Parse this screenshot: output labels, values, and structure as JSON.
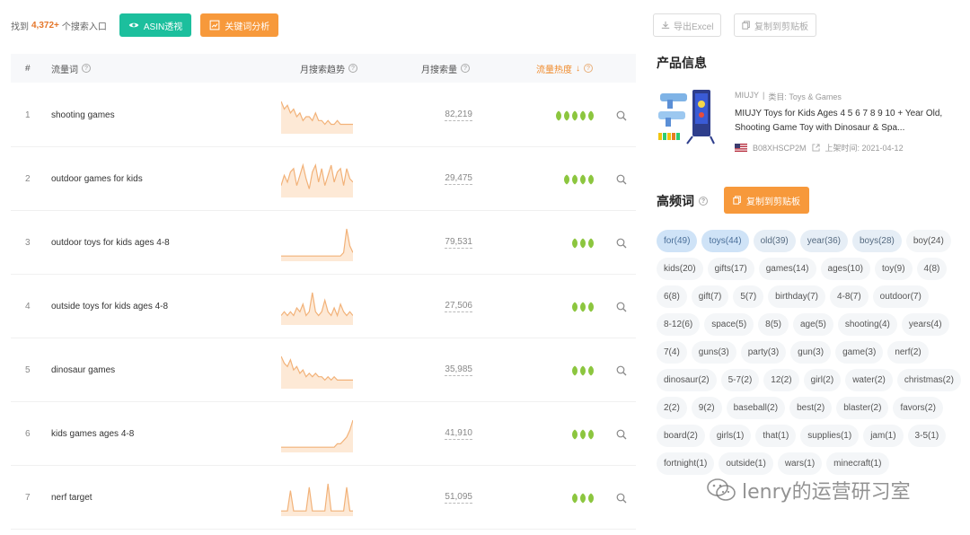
{
  "topbar": {
    "found_prefix": "找到",
    "found_count": "4,372+",
    "found_suffix": "个搜索入口",
    "asin_button": "ASIN透视",
    "keyword_button": "关键词分析"
  },
  "table": {
    "headers": {
      "index": "#",
      "keyword": "流量词",
      "trend": "月搜索趋势",
      "volume": "月搜索量",
      "heat": "流量热度"
    },
    "rows": [
      {
        "index": "1",
        "keyword": "shooting games",
        "volume": "82,219",
        "heat": 5,
        "trend": [
          8,
          6,
          7,
          5,
          6,
          4,
          5,
          3,
          4,
          4,
          3,
          5,
          3,
          3,
          2,
          3,
          2,
          2,
          3,
          2,
          2,
          2,
          2,
          2
        ]
      },
      {
        "index": "2",
        "keyword": "outdoor games for kids",
        "volume": "29,475",
        "heat": 4,
        "trend": [
          3,
          6,
          4,
          7,
          8,
          3,
          6,
          9,
          5,
          2,
          7,
          9,
          4,
          8,
          3,
          6,
          9,
          4,
          7,
          8,
          3,
          8,
          5,
          4
        ]
      },
      {
        "index": "3",
        "keyword": "outdoor toys for kids ages 4-8",
        "volume": "79,531",
        "heat": 3,
        "trend": [
          1,
          1,
          1,
          1,
          1,
          1,
          1,
          1,
          1,
          1,
          1,
          1,
          1,
          1,
          1,
          1,
          1,
          1,
          1,
          1,
          2,
          9,
          4,
          2
        ]
      },
      {
        "index": "4",
        "keyword": "outside toys for kids ages 4-8",
        "volume": "27,506",
        "heat": 3,
        "trend": [
          2,
          3,
          2,
          3,
          2,
          4,
          3,
          5,
          2,
          3,
          8,
          3,
          2,
          3,
          6,
          3,
          2,
          4,
          2,
          5,
          3,
          2,
          3,
          2
        ]
      },
      {
        "index": "5",
        "keyword": "dinosaur games",
        "volume": "35,985",
        "heat": 3,
        "trend": [
          9,
          7,
          6,
          8,
          5,
          6,
          4,
          5,
          3,
          4,
          3,
          4,
          3,
          3,
          2,
          3,
          2,
          3,
          2,
          2,
          2,
          2,
          2,
          2
        ]
      },
      {
        "index": "6",
        "keyword": "kids games ages 4-8",
        "volume": "41,910",
        "heat": 3,
        "trend": [
          1,
          1,
          1,
          1,
          1,
          1,
          1,
          1,
          1,
          1,
          1,
          1,
          1,
          1,
          1,
          1,
          1,
          1,
          2,
          2,
          3,
          4,
          6,
          9
        ]
      },
      {
        "index": "7",
        "keyword": "nerf target",
        "volume": "51,095",
        "heat": 3,
        "trend": [
          1,
          1,
          1,
          7,
          1,
          1,
          1,
          1,
          1,
          8,
          1,
          1,
          1,
          1,
          1,
          9,
          1,
          1,
          1,
          1,
          1,
          8,
          1,
          1
        ]
      }
    ]
  },
  "right": {
    "export_label": "导出Excel",
    "copy_clipboard_label": "复制到剪贴板",
    "product_title": "产品信息",
    "brand": "MIUJY",
    "category_label": "类目: Toys & Games",
    "product_name": "MIUJY Toys for Kids Ages 4 5 6 7 8 9 10 + Year Old, Shooting Game Toy with Dinosaur & Spa...",
    "asin": "B08XHSCP2M",
    "listing_date": "上架时间: 2021-04-12",
    "high_freq_title": "高频词",
    "copy_button_label": "复制到剪贴板",
    "tags": [
      {
        "text": "for(49)",
        "level": "hl"
      },
      {
        "text": "toys(44)",
        "level": "hl"
      },
      {
        "text": "old(39)",
        "level": "mid"
      },
      {
        "text": "year(36)",
        "level": "mid"
      },
      {
        "text": "boys(28)",
        "level": "mid"
      },
      {
        "text": "boy(24)",
        "level": ""
      },
      {
        "text": "kids(20)",
        "level": ""
      },
      {
        "text": "gifts(17)",
        "level": ""
      },
      {
        "text": "games(14)",
        "level": ""
      },
      {
        "text": "ages(10)",
        "level": ""
      },
      {
        "text": "toy(9)",
        "level": ""
      },
      {
        "text": "4(8)",
        "level": ""
      },
      {
        "text": "6(8)",
        "level": ""
      },
      {
        "text": "gift(7)",
        "level": ""
      },
      {
        "text": "5(7)",
        "level": ""
      },
      {
        "text": "birthday(7)",
        "level": ""
      },
      {
        "text": "4-8(7)",
        "level": ""
      },
      {
        "text": "outdoor(7)",
        "level": ""
      },
      {
        "text": "8-12(6)",
        "level": ""
      },
      {
        "text": "space(5)",
        "level": ""
      },
      {
        "text": "8(5)",
        "level": ""
      },
      {
        "text": "age(5)",
        "level": ""
      },
      {
        "text": "shooting(4)",
        "level": ""
      },
      {
        "text": "years(4)",
        "level": ""
      },
      {
        "text": "7(4)",
        "level": ""
      },
      {
        "text": "guns(3)",
        "level": ""
      },
      {
        "text": "party(3)",
        "level": ""
      },
      {
        "text": "gun(3)",
        "level": ""
      },
      {
        "text": "game(3)",
        "level": ""
      },
      {
        "text": "nerf(2)",
        "level": ""
      },
      {
        "text": "dinosaur(2)",
        "level": ""
      },
      {
        "text": "5-7(2)",
        "level": ""
      },
      {
        "text": "12(2)",
        "level": ""
      },
      {
        "text": "girl(2)",
        "level": ""
      },
      {
        "text": "water(2)",
        "level": ""
      },
      {
        "text": "christmas(2)",
        "level": ""
      },
      {
        "text": "2(2)",
        "level": ""
      },
      {
        "text": "9(2)",
        "level": ""
      },
      {
        "text": "baseball(2)",
        "level": ""
      },
      {
        "text": "best(2)",
        "level": ""
      },
      {
        "text": "blaster(2)",
        "level": ""
      },
      {
        "text": "favors(2)",
        "level": ""
      },
      {
        "text": "board(2)",
        "level": ""
      },
      {
        "text": "girls(1)",
        "level": ""
      },
      {
        "text": "that(1)",
        "level": ""
      },
      {
        "text": "supplies(1)",
        "level": ""
      },
      {
        "text": "jam(1)",
        "level": ""
      },
      {
        "text": "3-5(1)",
        "level": ""
      },
      {
        "text": "fortnight(1)",
        "level": ""
      },
      {
        "text": "outside(1)",
        "level": ""
      },
      {
        "text": "wars(1)",
        "level": ""
      },
      {
        "text": "minecraft(1)",
        "level": ""
      }
    ]
  },
  "watermark": "lenry的运营研习室",
  "colors": {
    "green": "#1cbf9d",
    "orange": "#f7993b",
    "leaf": "#8cc63f",
    "trend_line": "#f2b279",
    "trend_fill": "#fde9d6",
    "tag_highlight": "#cfe3f7"
  }
}
